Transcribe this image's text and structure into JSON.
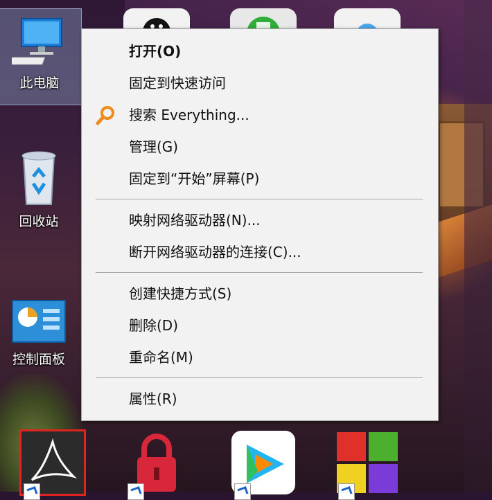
{
  "desktop": {
    "icons": [
      {
        "label": "此电脑"
      },
      {
        "label": "回收站"
      },
      {
        "label": "控制面板"
      }
    ]
  },
  "context_menu": {
    "items": [
      {
        "label": "打开(O)",
        "bold": true
      },
      {
        "label": "固定到快速访问"
      },
      {
        "label": "搜索 Everything...",
        "icon": "magnifier-icon"
      },
      {
        "label": "管理(G)"
      },
      {
        "label": "固定到“开始”屏幕(P)"
      },
      {
        "label": "映射网络驱动器(N)..."
      },
      {
        "label": "断开网络驱动器的连接(C)..."
      },
      {
        "label": "创建快捷方式(S)"
      },
      {
        "label": "删除(D)"
      },
      {
        "label": "重命名(M)"
      },
      {
        "label": "属性(R)"
      }
    ]
  },
  "colors": {
    "menu_bg": "#f2f2f2",
    "everything_icon": "#f08a1c",
    "shortcut_arrow": "#1b64c8"
  }
}
